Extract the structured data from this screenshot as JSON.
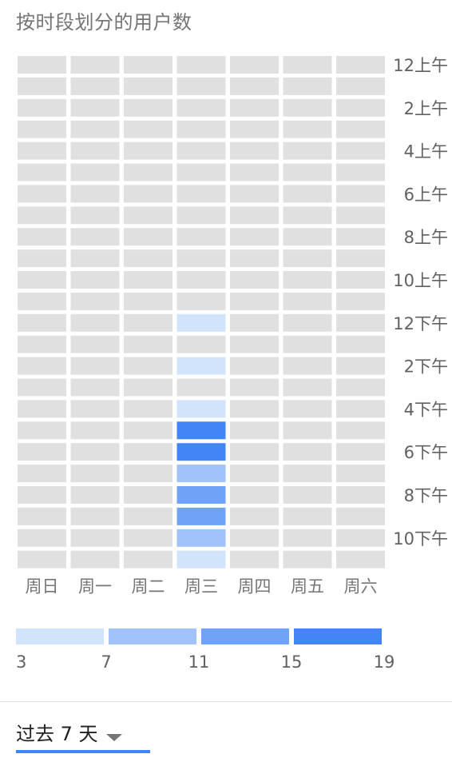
{
  "title": "按时段划分的用户数",
  "chart_data": {
    "type": "heatmap",
    "days": [
      "周日",
      "周一",
      "周二",
      "周三",
      "周四",
      "周五",
      "周六"
    ],
    "hour_labels": [
      "12上午",
      "2上午",
      "4上午",
      "6上午",
      "8上午",
      "10上午",
      "12下午",
      "2下午",
      "4下午",
      "6下午",
      "8下午",
      "10下午"
    ],
    "hours_per_day": 24,
    "values": [
      [
        0,
        0,
        0,
        0,
        0,
        0,
        0,
        0,
        0,
        0,
        0,
        0,
        0,
        0,
        0,
        0,
        0,
        0,
        0,
        0,
        0,
        0,
        0,
        0
      ],
      [
        0,
        0,
        0,
        0,
        0,
        0,
        0,
        0,
        0,
        0,
        0,
        0,
        0,
        0,
        0,
        0,
        0,
        0,
        0,
        0,
        0,
        0,
        0,
        0
      ],
      [
        0,
        0,
        0,
        0,
        0,
        0,
        0,
        0,
        0,
        0,
        0,
        0,
        0,
        0,
        0,
        0,
        0,
        0,
        0,
        0,
        0,
        0,
        0,
        0
      ],
      [
        0,
        0,
        0,
        0,
        0,
        0,
        0,
        0,
        0,
        0,
        0,
        0,
        3,
        0,
        3,
        0,
        3,
        19,
        19,
        7,
        11,
        11,
        7,
        3
      ],
      [
        0,
        0,
        0,
        0,
        0,
        0,
        0,
        0,
        0,
        0,
        0,
        0,
        0,
        0,
        0,
        0,
        0,
        0,
        0,
        0,
        0,
        0,
        0,
        0
      ],
      [
        0,
        0,
        0,
        0,
        0,
        0,
        0,
        0,
        0,
        0,
        0,
        0,
        0,
        0,
        0,
        0,
        0,
        0,
        0,
        0,
        0,
        0,
        0,
        0
      ],
      [
        0,
        0,
        0,
        0,
        0,
        0,
        0,
        0,
        0,
        0,
        0,
        0,
        0,
        0,
        0,
        0,
        0,
        0,
        0,
        0,
        0,
        0,
        0,
        0
      ]
    ],
    "legend": {
      "ticks": [
        "3",
        "7",
        "11",
        "15",
        "19"
      ],
      "colors": [
        "#d2e3fc",
        "#a1c2fa",
        "#6fa3f7",
        "#4285f4"
      ]
    },
    "empty_color": "#e0e0e0"
  },
  "range_selector": {
    "label": "过去 7 天"
  },
  "accent_color": "#4285f4"
}
